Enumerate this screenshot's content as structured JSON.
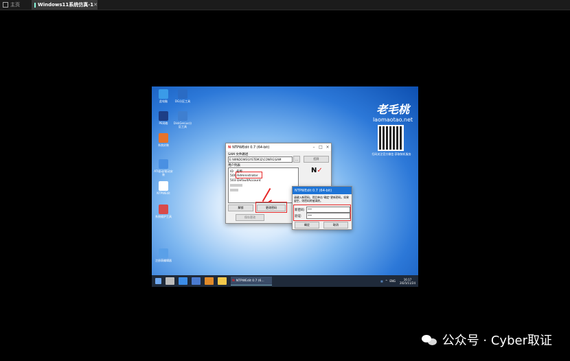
{
  "vm": {
    "home_tab": "主页",
    "active_tab": "Windows11系统仿真-1",
    "close": "✕"
  },
  "desktop": {
    "icons": [
      "此电脑",
      "DG分区工具",
      "PE网络",
      "DiskGenius分区工具",
      "系统封装",
      "ATI驱动/驱动安装",
      "NTPWEdit",
      "系统维护工具",
      "注册表编辑器"
    ],
    "brand_name": "老毛桃",
    "brand_url": "laomaotao.net",
    "qr_caption": "扫码关注官方微信 获取装机服务"
  },
  "ntpwedit": {
    "title": "NTPWEdit 0.7 (64-bit)",
    "sam_label": "SAM 文件路径",
    "sam_path": "E:\\WINDOWS\\SYSTEM32\\CONFIG\\SAM",
    "browse": "...",
    "open_button": "打开",
    "users_label": "用户列表",
    "col_id": "ID",
    "col_name": "名称",
    "users": [
      {
        "id": "500",
        "name": "Administrator"
      },
      {
        "id": "503",
        "name": "DefaultAccount"
      }
    ],
    "about_button": "关于",
    "unlock_button": "解锁",
    "change_password_button": "更改密码",
    "save_button": "保存更改"
  },
  "dialog": {
    "title": "NTPWEdit 0.7 (64-bit)",
    "instructions": "请键入新密码，然后单击“确定”更新密码。如果留空，则密码将被清除。",
    "new_password_label": "新密码:",
    "new_password_value": "***",
    "verify_label": "验证:",
    "verify_value": "***",
    "ok_button": "确定",
    "cancel_button": "取消"
  },
  "taskbar": {
    "active_app": "NTPWEdit 0.7 (6...",
    "lang": "ENG",
    "time": "16:17",
    "date": "2025/11/24"
  },
  "watermark": {
    "text": "公众号 · Cyber取证"
  }
}
